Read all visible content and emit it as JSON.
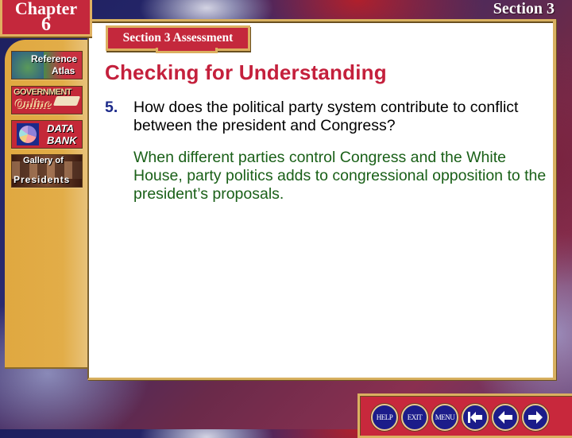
{
  "header": {
    "chapter_label": "Chapter",
    "chapter_number": "6",
    "section_label": "Section 3",
    "assessment_tab": "Section 3 Assessment"
  },
  "sidebar": {
    "items": [
      {
        "label_line1": "Reference",
        "label_line2": "Atlas",
        "icon": "globe-map-icon"
      },
      {
        "label_line1": "GOVERNMENT",
        "label_line2": "Online",
        "icon": "book-mouse-icon"
      },
      {
        "label_line1": "DATA",
        "label_line2": "BANK",
        "icon": "pie-chart-icon"
      },
      {
        "label_line1": "Gallery of",
        "label_line2": "Presidents",
        "icon": "presidents-portrait-icon"
      }
    ]
  },
  "content": {
    "heading": "Checking for Understanding",
    "question_number": "5.",
    "question": "How does the political party system contribute to conflict between the president and Congress?",
    "answer": "When different parties control Congress and the White House, party politics adds to congressional opposition to the president’s proposals."
  },
  "nav": {
    "help": "HELP",
    "exit": "EXIT",
    "menu": "MENU",
    "first_icon": "first-slide-icon",
    "prev_icon": "previous-arrow-icon",
    "next_icon": "next-arrow-icon"
  },
  "colors": {
    "heading_red": "#c4203c",
    "question_number_blue": "#1c2a8a",
    "answer_green": "#1a6018",
    "gold_frame": "#dcb060",
    "nav_button_blue": "#1c1c8a"
  }
}
